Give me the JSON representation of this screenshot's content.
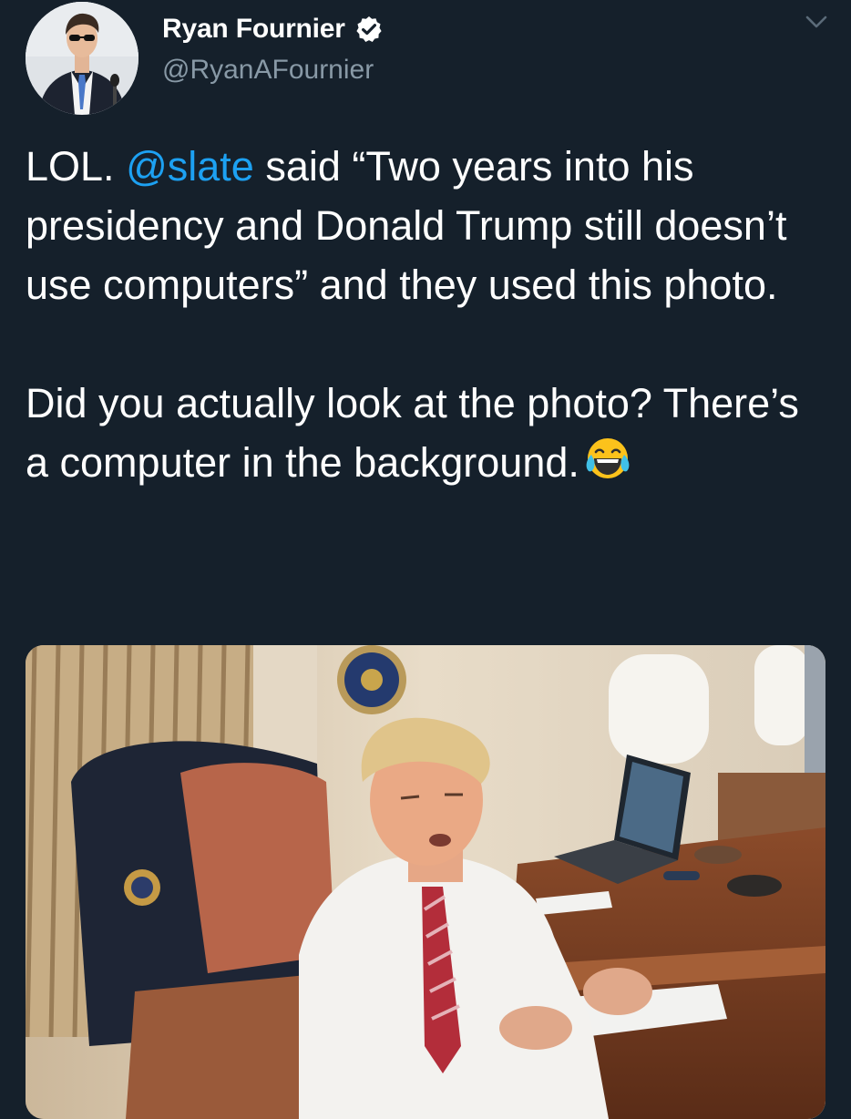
{
  "author": {
    "display_name": "Ryan Fournier",
    "handle": "@RyanAFournier",
    "verified": true,
    "avatar_icon": "profile-photo"
  },
  "tweet": {
    "line1_prefix": "LOL. ",
    "mention": "@slate",
    "line1_suffix": " said “Two years into his presidency and Donald Trump still doesn’t use computers” and they used this photo.",
    "paragraph2": "Did you actually look at the photo? There’s a computer in the background.",
    "emoji": "face-with-tears-of-joy"
  },
  "media": {
    "type": "photo",
    "icon": "photo-man-at-desk-with-laptop"
  },
  "menu": {
    "icon": "chevron-down-icon"
  },
  "colors": {
    "background": "#15202b",
    "text": "#ffffff",
    "secondary_text": "#8899a6",
    "link": "#1da1f2",
    "verified": "#ffffff"
  }
}
